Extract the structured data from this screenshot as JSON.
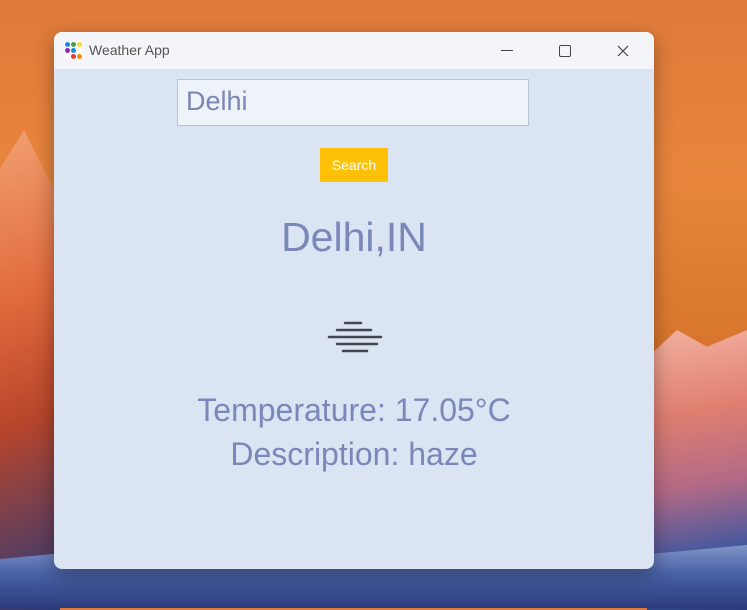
{
  "window": {
    "title": "Weather App",
    "app_icon": "app-dots-icon"
  },
  "search": {
    "value": "Delhi",
    "button_label": "Search",
    "button_color": "#ffc107"
  },
  "weather": {
    "city": "Delhi,IN",
    "icon": "haze-icon",
    "temperature": "Temperature: 17.05°C",
    "description": "Description: haze"
  },
  "colors": {
    "window_bg": "#dbe4f3",
    "text": "#7b87b8"
  }
}
